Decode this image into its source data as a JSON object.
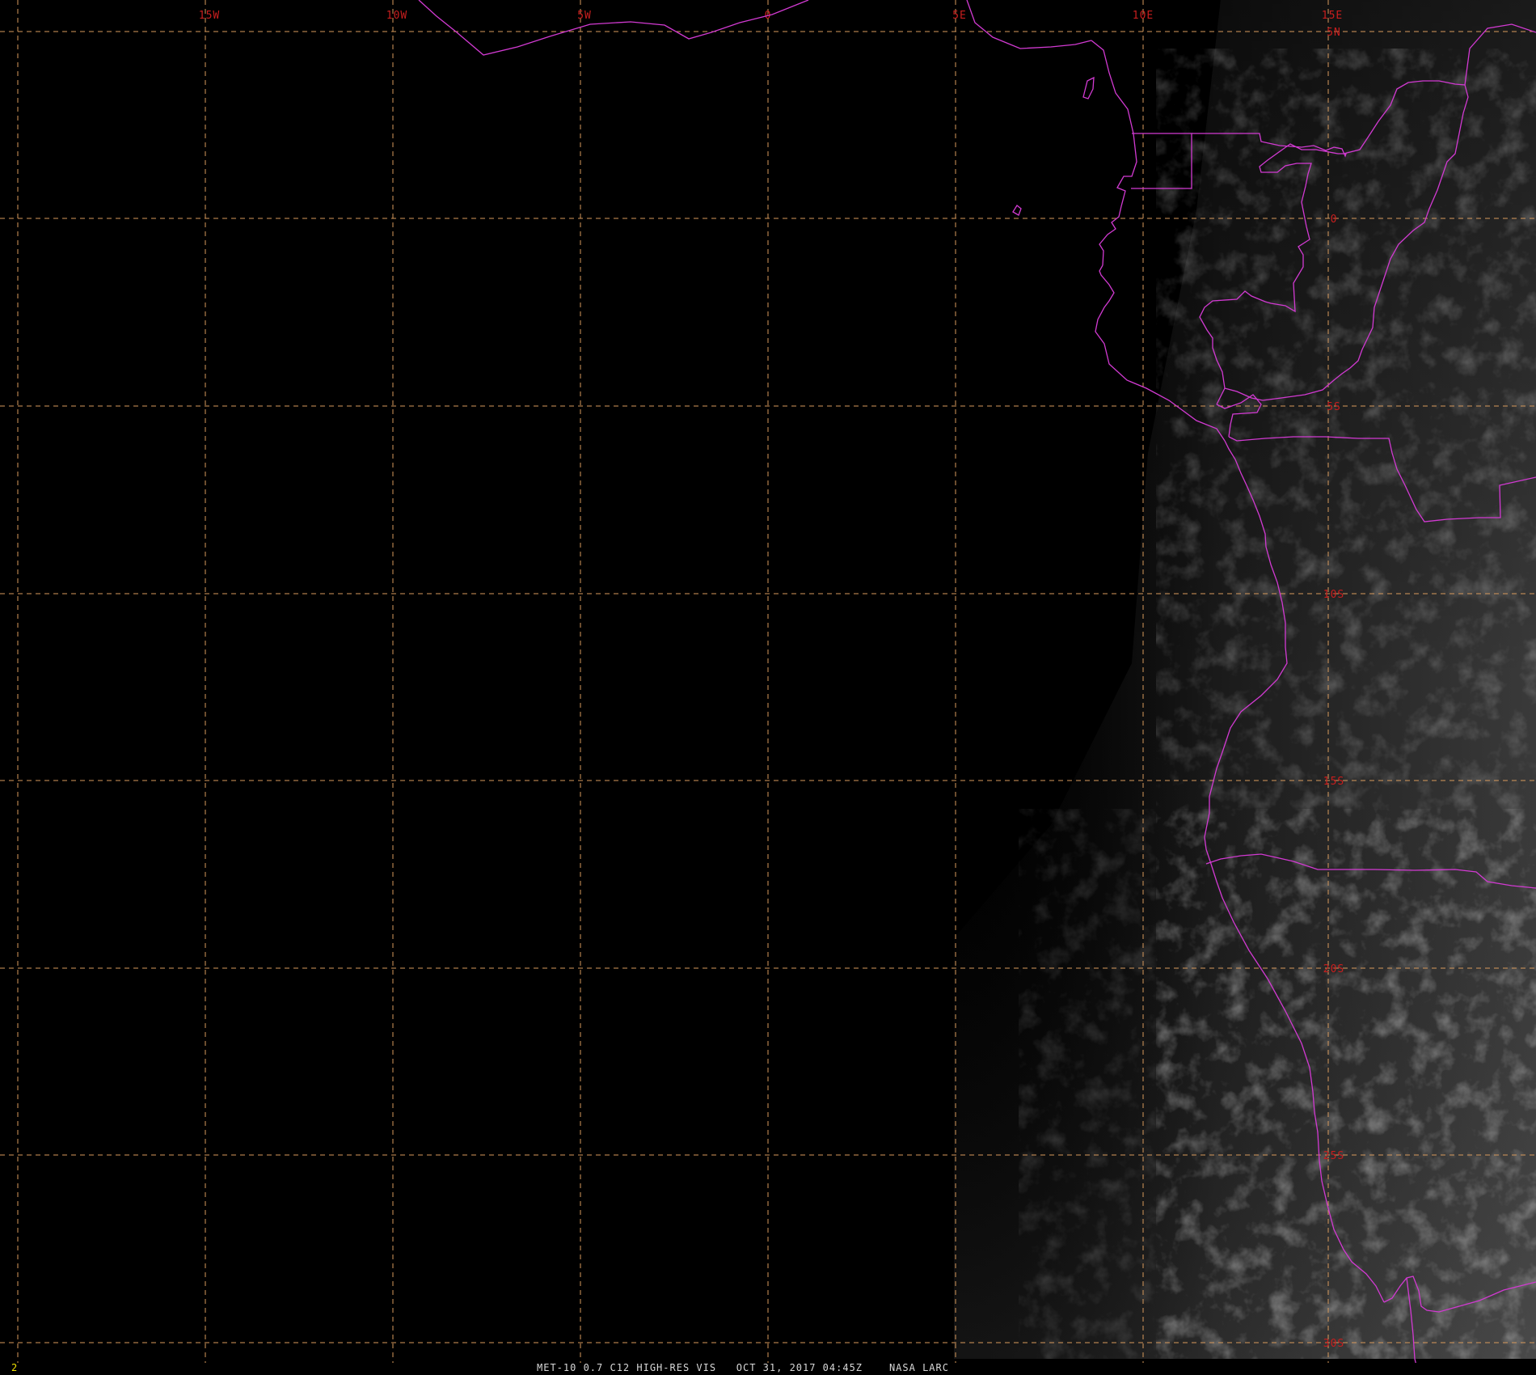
{
  "frame_number": "2",
  "caption": {
    "product": "MET-10 0.7 C12 HIGH-RES VIS",
    "datetime": "OCT 31, 2017 04:45Z",
    "credit": "NASA LARC"
  },
  "graticule": {
    "line_color": "#d89a5c",
    "label_color": "#c81e1e",
    "longitude_labels": [
      "15W",
      "10W",
      "5W",
      "0",
      "5E",
      "10E",
      "15E"
    ],
    "latitude_labels": [
      "5N",
      "0",
      "5S",
      "10S",
      "15S",
      "20S",
      "25S",
      "30S"
    ]
  },
  "colors": {
    "background": "#000000",
    "boundaries": "#d23ad2",
    "frame_number": "#f0e000",
    "caption": "#d8d8d8"
  }
}
